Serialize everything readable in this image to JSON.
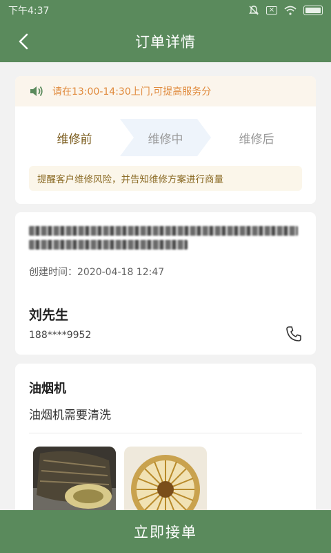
{
  "statusbar": {
    "time": "下午4:37",
    "icons": [
      "mute-icon",
      "x-box-icon",
      "wifi-icon",
      "battery-icon"
    ]
  },
  "navbar": {
    "title": "订单详情",
    "back_icon": "chevron-left-icon"
  },
  "order_status": {
    "notice": "请在13:00-14:30上门,可提高服务分",
    "steps": [
      {
        "label": "维修前",
        "active": true
      },
      {
        "label": "维修中",
        "active": false
      },
      {
        "label": "维修后",
        "active": false
      }
    ],
    "tip": "提醒客户维修风险，并告知维修方案进行商量"
  },
  "customer": {
    "created_label": "创建时间：2020-04-18 12:47",
    "name": "刘先生",
    "phone": "188****9952"
  },
  "device": {
    "name": "油烟机",
    "description": "油烟机需要清洗"
  },
  "action": {
    "accept_label": "立即接单"
  },
  "colors": {
    "brand_green": "#5a8a5c",
    "accent_orange": "#e08a3c",
    "step_active": "#fbe8a6"
  }
}
